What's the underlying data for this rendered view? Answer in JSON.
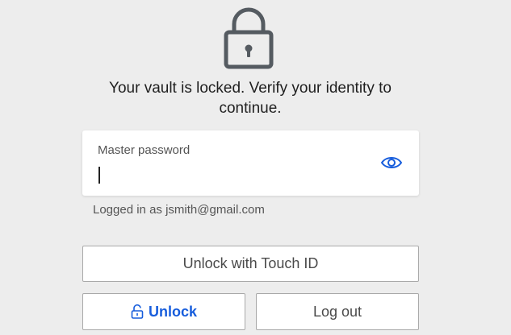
{
  "colors": {
    "background": "#ededed",
    "accent": "#175ddc",
    "lock_icon": "#555b61"
  },
  "lock": {
    "icon": "lock-icon",
    "message": "Your vault is locked. Verify your identity to continue."
  },
  "password": {
    "label": "Master password",
    "value": "",
    "toggle_icon": "eye-icon"
  },
  "account": {
    "logged_in_text": "Logged in as jsmith@gmail.com"
  },
  "buttons": {
    "touch_id": "Unlock with Touch ID",
    "unlock": "Unlock",
    "unlock_icon": "unlock-icon",
    "logout": "Log out"
  }
}
